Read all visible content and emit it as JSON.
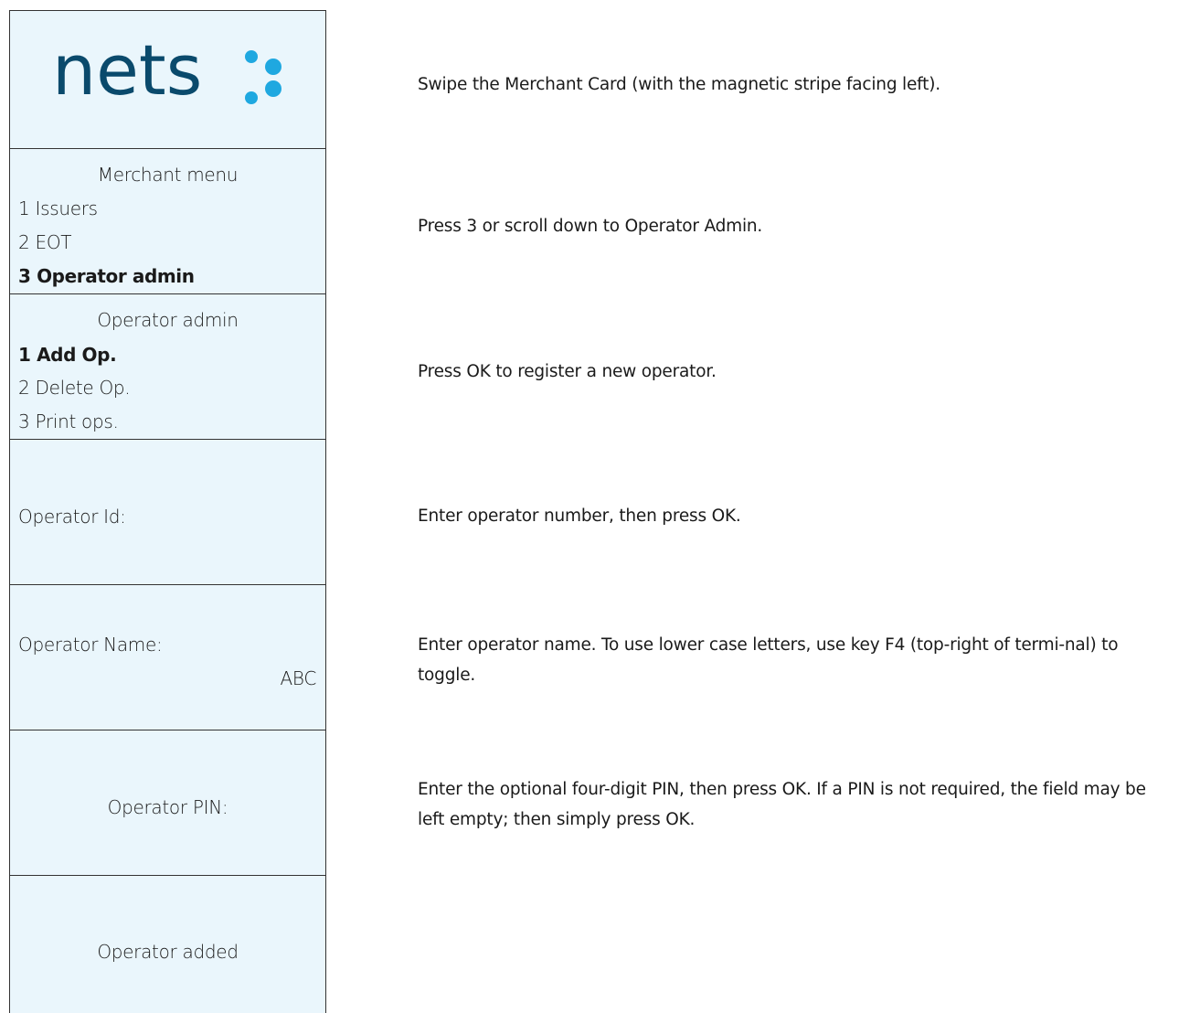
{
  "logo": {
    "text": "nets",
    "icon": "nets-dots-icon",
    "color": "#0a4a6c",
    "dot_color": "#1fa8e0"
  },
  "screens": {
    "merchant_menu": {
      "title": "Merchant menu",
      "items": [
        "1 Issuers",
        "2 EOT",
        "3 Operator admin"
      ]
    },
    "operator_admin": {
      "title": "Operator admin",
      "items": [
        "1 Add Op.",
        "2 Delete Op.",
        "3 Print ops."
      ]
    },
    "operator_id": {
      "label": "Operator Id:"
    },
    "operator_name": {
      "label": "Operator Name:",
      "mode": "ABC"
    },
    "operator_pin": {
      "label": "Operator PIN:"
    },
    "operator_added": {
      "label": "Operator added"
    }
  },
  "instructions": [
    "Swipe the Merchant Card (with the magnetic stripe facing left).",
    "Press 3 or scroll down to Operator Admin.",
    "Press OK to register a new operator.",
    "Enter operator number, then press OK.",
    "Enter operator name. To use lower case letters, use key F4 (top-right of termi-nal) to toggle.",
    "Enter the optional four-digit PIN, then press OK. If a PIN is not required, the field may be left empty; then simply press OK."
  ],
  "colors": {
    "screen_background": "#eaf6fc",
    "border": "#333333"
  }
}
